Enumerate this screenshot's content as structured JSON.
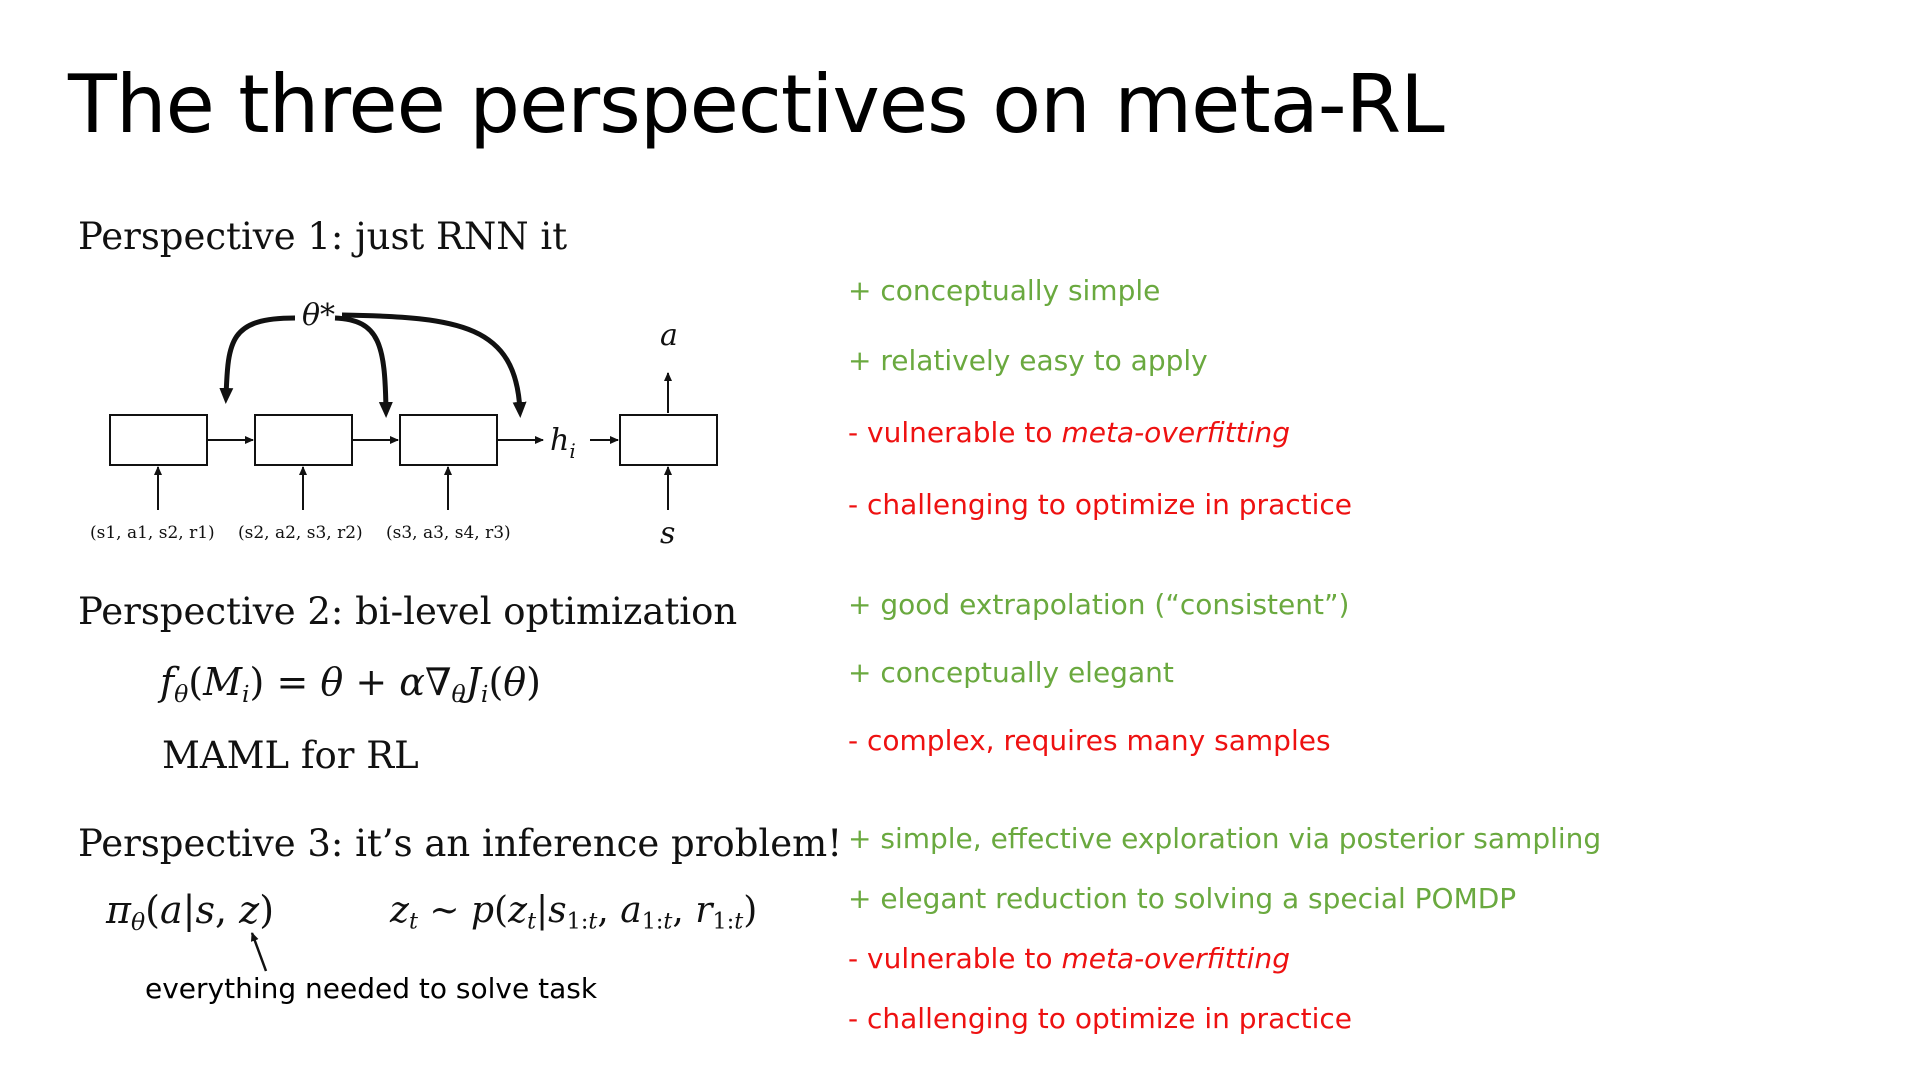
{
  "slide": {
    "title": "The three perspectives on meta-RL"
  },
  "perspective1": {
    "heading": "Perspective 1: just RNN it",
    "diagram": {
      "theta_label": "θ*",
      "hidden_label": "h",
      "hidden_sub": "i",
      "action_label": "a",
      "state_label": "s",
      "inputs": [
        "(s1, a1, s2, r1)",
        "(s2, a2, s3, r2)",
        "(s3, a3, s4, r3)"
      ]
    },
    "points": [
      {
        "type": "pro",
        "text": "+ conceptually simple"
      },
      {
        "type": "pro",
        "text": "+ relatively easy to apply"
      },
      {
        "type": "con",
        "prefix": "- vulnerable to ",
        "emph": "meta-overfitting"
      },
      {
        "type": "con",
        "text": "- challenging to optimize in practice"
      }
    ]
  },
  "perspective2": {
    "heading": "Perspective 2: bi-level optimization",
    "equation": "fθ(Mi) = θ + α∇θJi(θ)",
    "subheading": "MAML for RL",
    "points": [
      {
        "type": "pro",
        "text": "+ good extrapolation (“consistent”)"
      },
      {
        "type": "pro",
        "text": "+ conceptually elegant"
      },
      {
        "type": "con",
        "text": "- complex, requires many samples"
      }
    ]
  },
  "perspective3": {
    "heading": "Perspective 3: it’s an inference problem!",
    "policy": "πθ(a|s, z)",
    "posterior": "zt ∼ p(zt|s1:t, a1:t, r1:t)",
    "note": "everything needed to solve task",
    "points": [
      {
        "type": "pro",
        "text": "+ simple, effective exploration via posterior sampling"
      },
      {
        "type": "pro",
        "text": "+ elegant reduction to solving a special POMDP"
      },
      {
        "type": "con",
        "prefix": "- vulnerable to ",
        "emph": "meta-overfitting"
      },
      {
        "type": "con",
        "text": "- challenging to optimize in practice"
      }
    ]
  },
  "colors": {
    "pro": "#6aa93f",
    "con": "#ee1111"
  }
}
